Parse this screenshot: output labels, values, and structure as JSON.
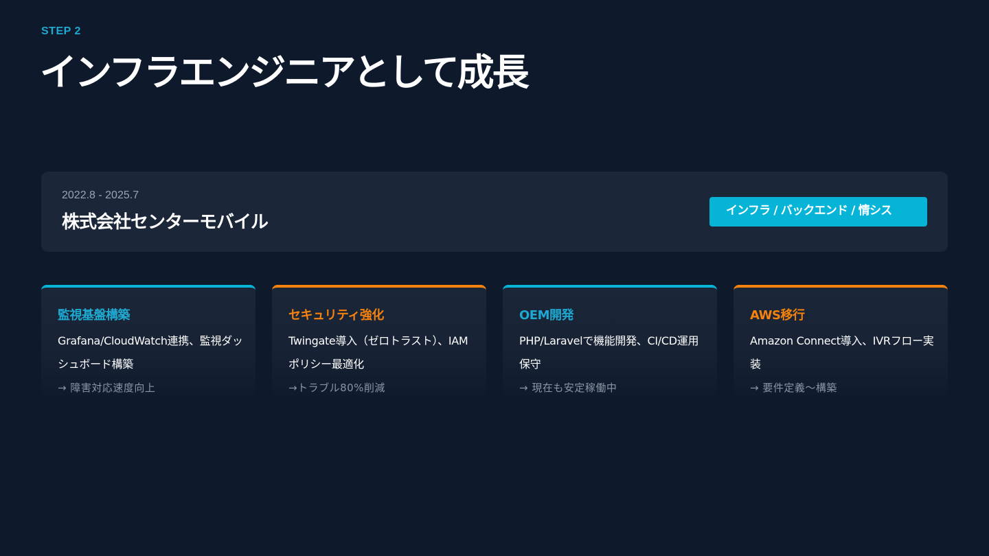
{
  "header": {
    "step": "STEP 2",
    "title": "インフラエンジニアとして成長"
  },
  "company": {
    "period": "2022.8 - 2025.7",
    "name": "株式会社センターモバイル",
    "roles": "インフラ / バックエンド / 情シス"
  },
  "colors": {
    "accent_blue": "#06b4d8",
    "accent_orange": "#f5820d",
    "background": "#0e1a2b",
    "card": "#1b2639"
  },
  "skills": [
    {
      "title": "監視基盤構築",
      "description": "Grafana/CloudWatch連携、監視ダッシュボード構築",
      "result": "→ 障害対応速度向上",
      "accent": "blue"
    },
    {
      "title": "セキュリティ強化",
      "description": "Twingate導入（ゼロトラスト）、IAMポリシー最適化",
      "result": "→トラブル80%削減",
      "accent": "orange"
    },
    {
      "title": "OEM開発",
      "description": "PHP/Laravelで機能開発、CI/CD運用保守",
      "result": "→ 現在も安定稼働中",
      "accent": "blue"
    },
    {
      "title": "AWS移行",
      "description": "Amazon Connect導入、IVRフロー実装",
      "result": "→ 要件定義〜構築",
      "accent": "orange"
    }
  ]
}
